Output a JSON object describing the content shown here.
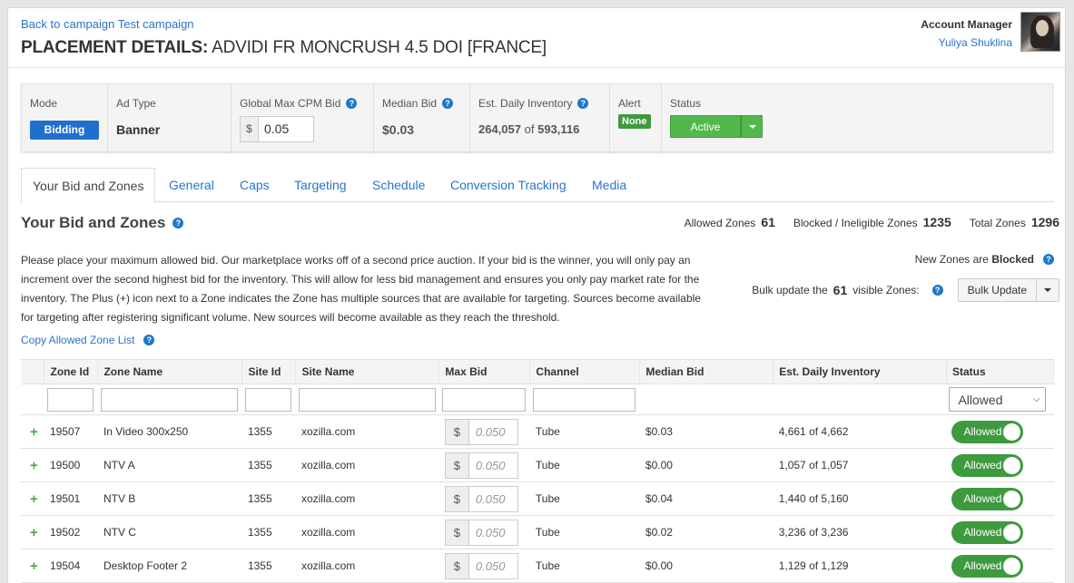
{
  "header": {
    "back_link": "Back to campaign Test campaign",
    "title_prefix": "PLACEMENT DETAILS:",
    "title_name": "ADVIDI FR MONCRUSH 4.5 DOI [FRANCE]",
    "account_manager_label": "Account Manager",
    "account_manager_name": "Yuliya Shuklina"
  },
  "summary": {
    "mode_label": "Mode",
    "mode_value": "Bidding",
    "ad_type_label": "Ad Type",
    "ad_type_value": "Banner",
    "global_cpm_label": "Global Max CPM Bid",
    "global_cpm_prefix": "$",
    "global_cpm_value": "0.05",
    "median_bid_label": "Median Bid",
    "median_bid_value": "$0.03",
    "inventory_label": "Est. Daily Inventory",
    "inventory_available": "264,057",
    "inventory_of": "of",
    "inventory_total": "593,116",
    "alert_label": "Alert",
    "alert_value": "None",
    "status_label": "Status",
    "status_value": "Active"
  },
  "tabs": [
    "Your Bid and Zones",
    "General",
    "Caps",
    "Targeting",
    "Schedule",
    "Conversion Tracking",
    "Media"
  ],
  "section": {
    "title": "Your Bid and Zones",
    "allowed_label": "Allowed Zones",
    "allowed_count": "61",
    "blocked_label": "Blocked / Ineligible Zones",
    "blocked_count": "1235",
    "total_label": "Total Zones",
    "total_count": "1296",
    "description": "Please place your maximum allowed bid. Our marketplace works off of a second price auction. If your bid is the winner, you will only pay an increment over the second highest bid for the inventory. This will allow for less bid management and ensures you only pay market rate for the inventory. The Plus (+) icon next to a Zone indicates the Zone has multiple sources that are available for targeting. Sources become available for targeting after registering significant volume. New sources will become available as they reach the threshold.",
    "new_zones_text": "New Zones are",
    "new_zones_state": "Blocked",
    "bulk_prefix": "Bulk update the",
    "bulk_count": "61",
    "bulk_suffix": "visible Zones:",
    "bulk_button": "Bulk Update",
    "copy_link": "Copy Allowed Zone List"
  },
  "table": {
    "headers": [
      "Zone Id",
      "Zone Name",
      "Site Id",
      "Site Name",
      "Max Bid",
      "Channel",
      "Median Bid",
      "Est. Daily Inventory",
      "Status"
    ],
    "status_filter": "Allowed",
    "bid_prefix": "$",
    "bid_placeholder": "0.050",
    "rows": [
      {
        "plus": "+",
        "zone_id": "19507",
        "zone_name": "In Video 300x250",
        "site_id": "1355",
        "site_name": "xozilla.com",
        "channel": "Tube",
        "median_bid": "$0.03",
        "inventory": "4,661 of 4,662",
        "status": "Allowed"
      },
      {
        "plus": "+",
        "zone_id": "19500",
        "zone_name": "NTV A",
        "site_id": "1355",
        "site_name": "xozilla.com",
        "channel": "Tube",
        "median_bid": "$0.00",
        "inventory": "1,057 of 1,057",
        "status": "Allowed"
      },
      {
        "plus": "+",
        "zone_id": "19501",
        "zone_name": "NTV B",
        "site_id": "1355",
        "site_name": "xozilla.com",
        "channel": "Tube",
        "median_bid": "$0.04",
        "inventory": "1,440 of 5,160",
        "status": "Allowed"
      },
      {
        "plus": "+",
        "zone_id": "19502",
        "zone_name": "NTV C",
        "site_id": "1355",
        "site_name": "xozilla.com",
        "channel": "Tube",
        "median_bid": "$0.02",
        "inventory": "3,236 of 3,236",
        "status": "Allowed"
      },
      {
        "plus": "+",
        "zone_id": "19504",
        "zone_name": "Desktop Footer 2",
        "site_id": "1355",
        "site_name": "xozilla.com",
        "channel": "Tube",
        "median_bid": "$0.00",
        "inventory": "1,129 of 1,129",
        "status": "Allowed"
      }
    ]
  }
}
